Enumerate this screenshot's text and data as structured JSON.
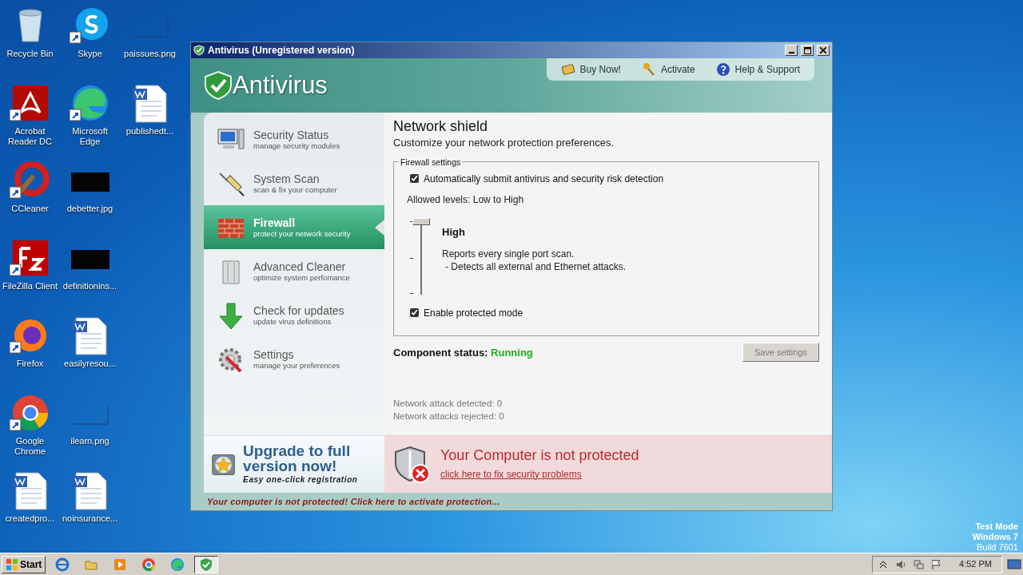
{
  "desktop": {
    "icons": [
      {
        "label": "Recycle Bin",
        "kind": "recycle"
      },
      {
        "label": "Acrobat Reader DC",
        "kind": "pdf"
      },
      {
        "label": "CCleaner",
        "kind": "brush"
      },
      {
        "label": "FileZilla Client",
        "kind": "ftp"
      },
      {
        "label": "Firefox",
        "kind": "fox"
      },
      {
        "label": "Google Chrome",
        "kind": "globe"
      },
      {
        "label": "createdpro...",
        "kind": "doc"
      },
      {
        "label": "Skype",
        "kind": "chat"
      },
      {
        "label": "Microsoft Edge",
        "kind": "wave"
      },
      {
        "label": "debetter.jpg",
        "kind": "dark"
      },
      {
        "label": "definitionins...",
        "kind": "dark"
      },
      {
        "label": "easilyresou...",
        "kind": "doc"
      },
      {
        "label": "ilearn.png",
        "kind": "blank"
      },
      {
        "label": "noinsurance...",
        "kind": "doc"
      },
      {
        "label": "paissues.png",
        "kind": "blank"
      },
      {
        "label": "publishedt...",
        "kind": "doc"
      }
    ],
    "os_info": [
      "Test Mode",
      "Windows 7",
      "Build 7601"
    ]
  },
  "window": {
    "title": "Antivirus (Unregistered version)",
    "header": {
      "logo": "Antivirus",
      "links": [
        {
          "label": "Buy Now!",
          "kind": "box"
        },
        {
          "label": "Activate",
          "kind": "key"
        },
        {
          "label": "Help & Support",
          "kind": "help"
        }
      ]
    },
    "sidebar": {
      "items": [
        {
          "title": "Security Status",
          "subtitle": "manage security modules",
          "kind": "monitor",
          "selected": false
        },
        {
          "title": "System Scan",
          "subtitle": "scan & fix your computer",
          "kind": "syringe",
          "selected": false
        },
        {
          "title": "Firewall",
          "subtitle": "protect your network security",
          "kind": "wall",
          "selected": true
        },
        {
          "title": "Advanced Cleaner",
          "subtitle": "optimize system perfomance",
          "kind": "bin",
          "selected": false
        },
        {
          "title": "Check for updates",
          "subtitle": "update virus definitions",
          "kind": "down",
          "selected": false
        },
        {
          "title": "Settings",
          "subtitle": "manage your preferences",
          "kind": "gear",
          "selected": false
        }
      ],
      "upgrade": {
        "title": "Upgrade to full version now!",
        "subtitle": "Easy one-click registration"
      }
    },
    "content": {
      "heading": "Network shield",
      "subheading": "Customize your network protection preferences.",
      "group": {
        "legend": "Firewall settings",
        "auto_submit": {
          "label": "Automatically submit antivirus and security risk detection",
          "checked": true
        },
        "allowed_levels": "Allowed levels: Low to High",
        "slider": {
          "level": 1,
          "level_name": "High",
          "description": [
            "Reports every single port scan.",
            "- Detects all external and Ethernet attacks."
          ]
        },
        "protected_mode": {
          "label": "Enable protected mode",
          "checked": true
        }
      },
      "component_status": {
        "label": "Component status:",
        "value": "Running"
      },
      "save_button": {
        "label": "Save settings",
        "disabled": true
      },
      "stats": [
        "Network attack detected: 0",
        "Network attacks rejected: 0"
      ]
    },
    "alert": {
      "title": "Your Computer is not protected",
      "link": "click here to fix security problems"
    },
    "status_bar": "Your computer is not protected! Click here to activate protection..."
  },
  "taskbar": {
    "start": "Start",
    "apps": [
      {
        "kind": "ie",
        "selected": false
      },
      {
        "kind": "folder",
        "selected": false
      },
      {
        "kind": "media",
        "selected": false
      },
      {
        "kind": "globe",
        "selected": false
      },
      {
        "kind": "wave",
        "selected": false
      },
      {
        "kind": "shield",
        "selected": true
      }
    ],
    "clock": "4:52 PM"
  }
}
